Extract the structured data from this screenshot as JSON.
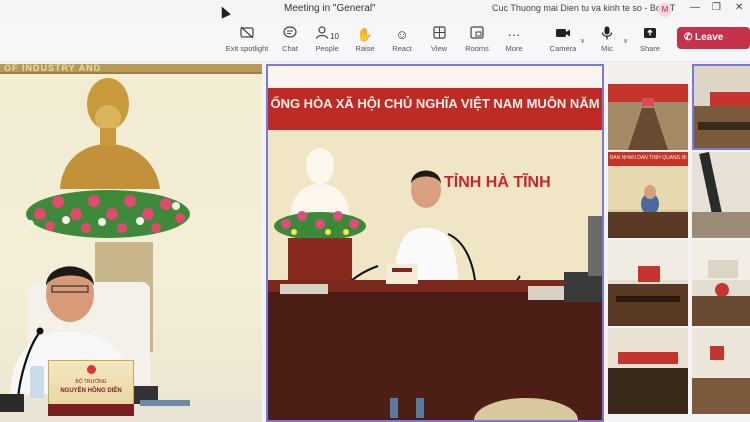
{
  "window": {
    "title": "Meeting in \"General\"",
    "meeting_name": "Cuc Thuong mai Dien tu va kinh te so - Bo CT",
    "user_initial": "M"
  },
  "toolbar": {
    "exit_spotlight": "Exit spotlight",
    "chat": "Chat",
    "people": "People",
    "people_count": "10",
    "raise": "Raise",
    "react": "React",
    "view": "View",
    "rooms": "Rooms",
    "more": "More",
    "camera": "Camera",
    "mic": "Mic",
    "share": "Share",
    "leave": "Leave"
  },
  "videos": {
    "left": {
      "banner_partial": "OF INDUSTRY AND",
      "nameplate_title": "BỘ TRƯỞNG",
      "nameplate_name": "NGUYỄN HỒNG DIÊN"
    },
    "center": {
      "banner": "ỐNG HÒA XÃ HỘI CHỦ NGHĨA VIỆT NAM MUÔN NĂM",
      "location": "TỈNH HÀ TĨNH"
    },
    "tiles": {
      "t2": "BAN NHÂN DÂN TỈNH QUẢNG BÌ"
    }
  },
  "icons": [
    "exit-spotlight-icon",
    "chat-icon",
    "people-icon",
    "raise-hand-icon",
    "react-icon",
    "view-icon",
    "rooms-icon",
    "more-icon",
    "camera-icon",
    "mic-icon",
    "share-icon",
    "phone-icon"
  ],
  "colors": {
    "leave": "#c4314b",
    "spotlight_border": "#7a78d8",
    "banner_red": "#c02a26"
  }
}
